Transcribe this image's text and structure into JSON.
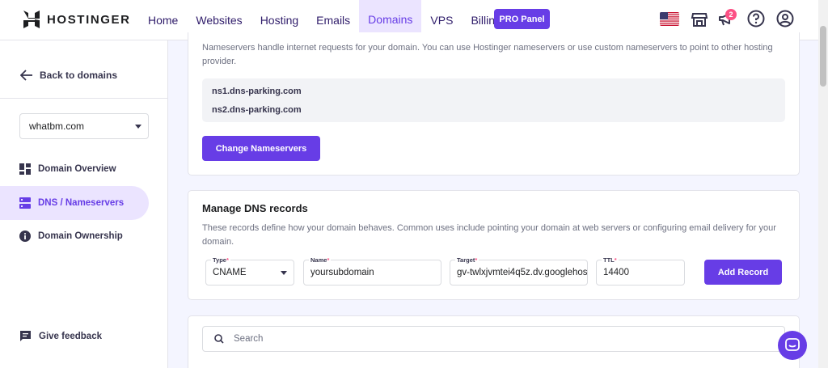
{
  "brand": {
    "name": "HOSTINGER"
  },
  "nav": {
    "items": [
      {
        "label": "Home"
      },
      {
        "label": "Websites"
      },
      {
        "label": "Hosting"
      },
      {
        "label": "Emails"
      },
      {
        "label": "Domains",
        "active": true
      },
      {
        "label": "VPS"
      },
      {
        "label": "Billing"
      }
    ],
    "pro_panel": "PRO Panel",
    "notifications_count": "2"
  },
  "sidebar": {
    "back_label": "Back to domains",
    "domain_selected": "whatbm.com",
    "items": [
      {
        "label": "Domain Overview",
        "icon": "dashboard-icon"
      },
      {
        "label": "DNS / Nameservers",
        "icon": "dns-icon",
        "active": true
      },
      {
        "label": "Domain Ownership",
        "icon": "info-icon"
      }
    ],
    "feedback_label": "Give feedback"
  },
  "nameservers": {
    "description": "Nameservers handle internet requests for your domain. You can use Hostinger nameservers or use custom nameservers to point to other hosting provider.",
    "ns1": "ns1.dns-parking.com",
    "ns2": "ns2.dns-parking.com",
    "change_button": "Change Nameservers"
  },
  "dns": {
    "title": "Manage DNS records",
    "description": "These records define how your domain behaves. Common uses include pointing your domain at web servers or configuring email delivery for your domain.",
    "type_label": "Type",
    "type_value": "CNAME",
    "name_label": "Name",
    "name_value": "yoursubdomain",
    "target_label": "Target",
    "target_value": "gv-twlxjvmtei4q5z.dv.googlehos",
    "ttl_label": "TTL",
    "ttl_value": "14400",
    "add_button": "Add Record",
    "required_mark": "*"
  },
  "search": {
    "placeholder": "Search"
  },
  "colors": {
    "accent": "#673de6",
    "accent_light": "#ebe4ff",
    "badge": "#fc5185"
  }
}
